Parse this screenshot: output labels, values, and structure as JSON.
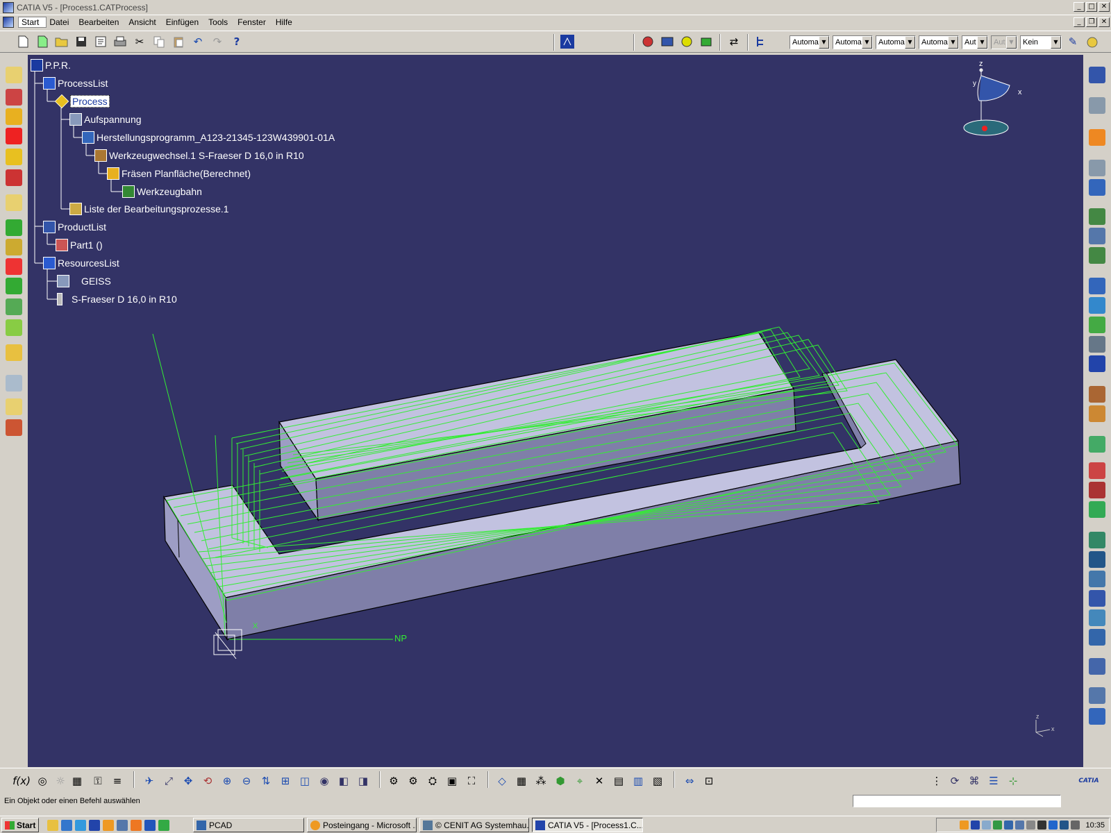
{
  "window": {
    "title": "CATIA V5 - [Process1.CATProcess]"
  },
  "menu": [
    "Start",
    "Datei",
    "Bearbeiten",
    "Ansicht",
    "Einfügen",
    "Tools",
    "Fenster",
    "Hilfe"
  ],
  "toolbar": {
    "dropdowns": [
      {
        "value": "Automa",
        "disabled": false
      },
      {
        "value": "Automa",
        "disabled": false
      },
      {
        "value": "Automa",
        "disabled": false
      },
      {
        "value": "Automa",
        "disabled": false
      },
      {
        "value": "Aut",
        "disabled": false
      },
      {
        "value": "Aut",
        "disabled": true
      },
      {
        "value": "Kein",
        "disabled": false
      }
    ]
  },
  "tree": {
    "nodes": [
      {
        "label": "P.P.R.",
        "selected": false
      },
      {
        "label": "ProcessList",
        "selected": false
      },
      {
        "label": "Process",
        "selected": true
      },
      {
        "label": "Aufspannung",
        "selected": false
      },
      {
        "label": "Herstellungsprogramm_A123-21345-123W439901-01A",
        "selected": false
      },
      {
        "label": "Werkzeugwechsel.1  S-Fraeser D 16,0 in R10",
        "selected": false
      },
      {
        "label": "Fräsen Planfläche(Berechnet)",
        "selected": false
      },
      {
        "label": "Werkzeugbahn",
        "selected": false
      },
      {
        "label": "Liste der Bearbeitungsprozesse.1",
        "selected": false
      },
      {
        "label": "ProductList",
        "selected": false
      },
      {
        "label": "Part1 ()",
        "selected": false
      },
      {
        "label": "ResourcesList",
        "selected": false
      },
      {
        "label": "GEISS",
        "selected": false
      },
      {
        "label": "S-Fraeser D 16,0 in R10",
        "selected": false
      }
    ]
  },
  "viewport": {
    "background": "#333366",
    "part_color": "#b8b8dc",
    "toolpath_color": "#33ee33",
    "compass_labels": {
      "z": "z",
      "x": "x",
      "y": "y"
    },
    "origin_label": "NP",
    "axis_x_label": "X",
    "mini_axis_z": "z",
    "mini_axis_x": "x"
  },
  "status": {
    "text": "Ein Objekt oder einen Befehl auswählen"
  },
  "taskbar": {
    "start": "Start",
    "tasks": [
      {
        "label": "PCAD",
        "active": false
      },
      {
        "label": "Posteingang - Microsoft ...",
        "active": false
      },
      {
        "label": "© CENIT AG Systemhau...",
        "active": false
      },
      {
        "label": "CATIA V5 - [Process1.C...",
        "active": true
      }
    ],
    "clock": "10:35"
  },
  "brand": {
    "logo_text": "CATIA"
  }
}
